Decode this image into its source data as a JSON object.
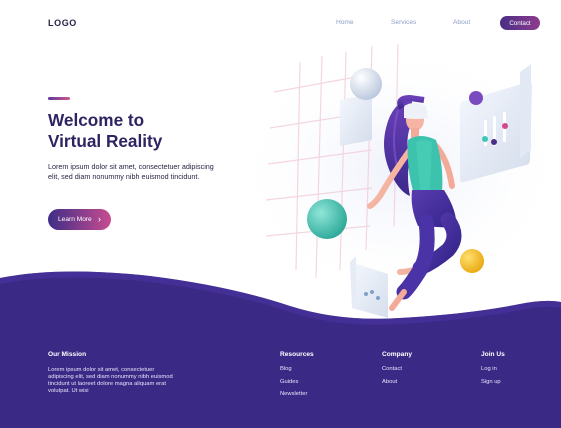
{
  "header": {
    "logo": "LOGO",
    "nav": [
      "Home",
      "Services",
      "About"
    ],
    "contact_label": "Contact"
  },
  "hero": {
    "title_line1": "Welcome to",
    "title_line2": "Virtual Reality",
    "description": "Lorem ipsum dolor sit amet, consectetuer adipiscing elit, sed diam nonummy nibh euismod tincidunt.",
    "button_label": "Learn More",
    "button_icon": "chevron-right-icon"
  },
  "footer": {
    "mission_heading": "Our Mission",
    "mission_text": "Lorem ipsum dolor sit amet, consectetuer adipiscing elit, sed diam nonummy nibh euismod tincidunt ut laoreet dolore magna aliquam erat volutpat. Ut wisi",
    "resources_heading": "Resources",
    "resources_links": [
      "Blog",
      "Guides",
      "Newsletter"
    ],
    "company_heading": "Company",
    "company_links": [
      "Contact",
      "About"
    ],
    "join_heading": "Join Us",
    "join_links": [
      "Log in",
      "Sign up"
    ]
  },
  "colors": {
    "brand_dark": "#2d2462",
    "footer_bg": "#3a2a86",
    "accent_pink": "#c84c90",
    "teal": "#3ec6b4",
    "yellow": "#f2c21a"
  }
}
